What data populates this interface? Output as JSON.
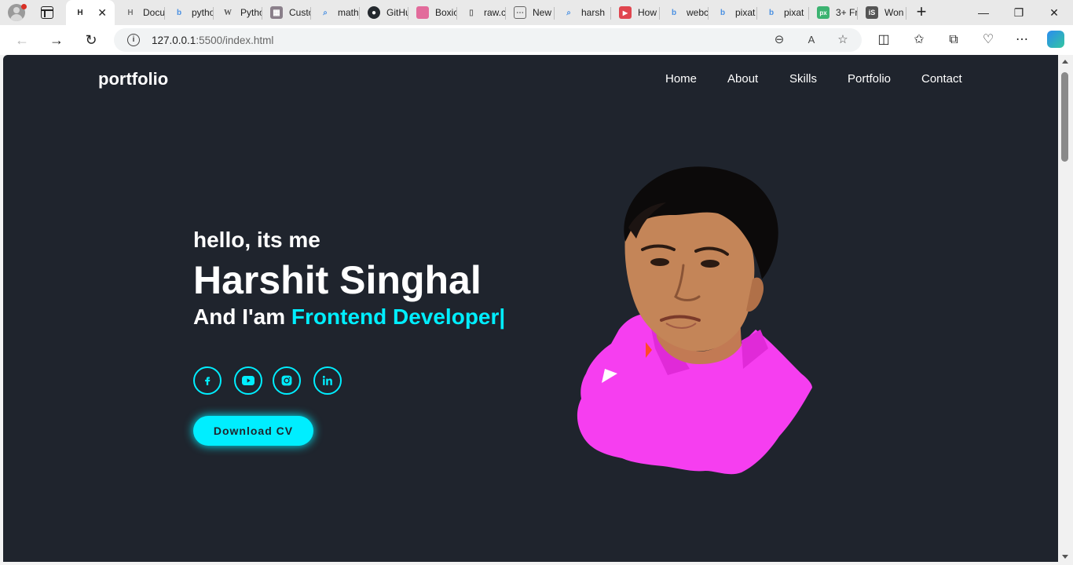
{
  "browser": {
    "tabs": [
      {
        "label": "",
        "favicon": "html-icon",
        "active": true
      },
      {
        "label": "Docu",
        "favicon": "html-icon"
      },
      {
        "label": "pytho",
        "favicon": "bing-icon"
      },
      {
        "label": "Pytho",
        "favicon": "wikipedia-icon"
      },
      {
        "label": "Custo",
        "favicon": "grid-icon"
      },
      {
        "label": "math",
        "favicon": "search-icon"
      },
      {
        "label": "GitHu",
        "favicon": "github-icon"
      },
      {
        "label": "Boxic",
        "favicon": "boxicons-icon"
      },
      {
        "label": "raw.c",
        "favicon": "file-icon"
      },
      {
        "label": "New",
        "favicon": "newtab-icon"
      },
      {
        "label": "harsh",
        "favicon": "search-icon"
      },
      {
        "label": "How",
        "favicon": "youtube-icon"
      },
      {
        "label": "webc",
        "favicon": "bing-icon"
      },
      {
        "label": "pixat",
        "favicon": "bing-icon"
      },
      {
        "label": "pixat",
        "favicon": "bing-icon"
      },
      {
        "label": "3+ Fr",
        "favicon": "pixabay-icon"
      },
      {
        "label": "Won",
        "favicon": "istock-icon"
      }
    ],
    "address": {
      "host": "127.0.0.1",
      "rest": ":5500/index.html"
    }
  },
  "site": {
    "logo": "portfolio",
    "nav": [
      "Home",
      "About",
      "Skills",
      "Portfolio",
      "Contact"
    ],
    "hero": {
      "greeting": "hello, its me",
      "name": "Harshit Singhal",
      "role_prefix": "And I'am",
      "role_typed": "Frontend Developer|",
      "cv_button": "Download CV"
    },
    "socials": [
      "facebook-icon",
      "youtube-icon",
      "instagram-icon",
      "linkedin-icon"
    ]
  },
  "colors": {
    "page_bg": "#1f242d",
    "accent": "#00eeff",
    "text": "#ffffff"
  }
}
